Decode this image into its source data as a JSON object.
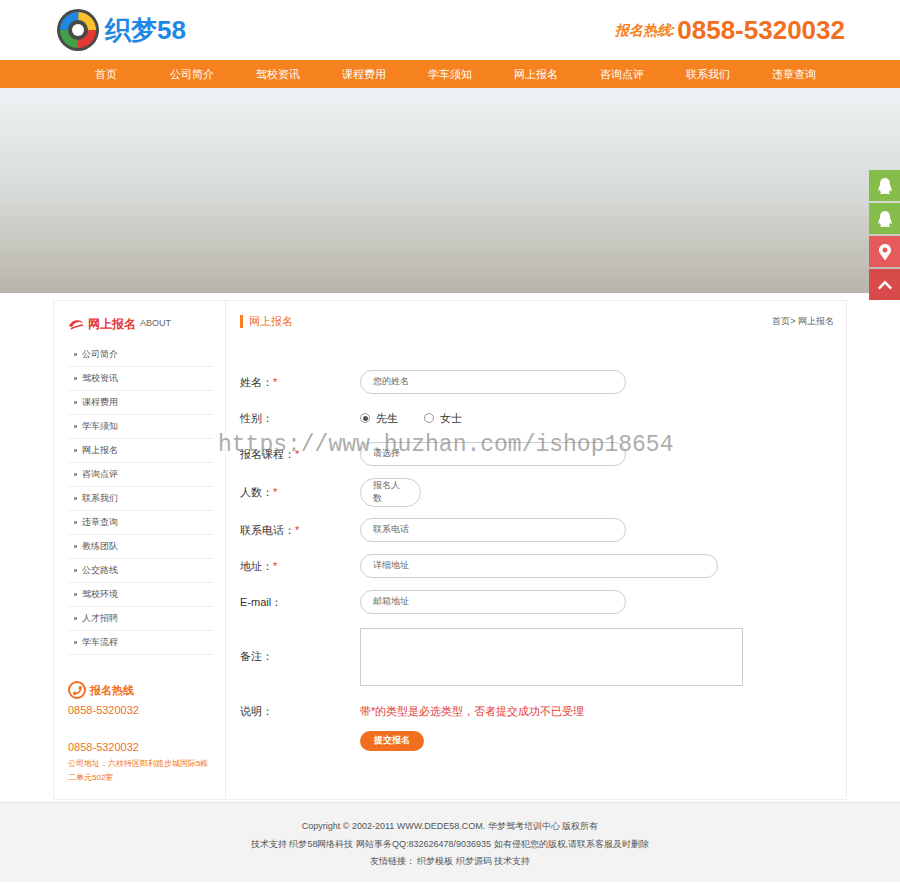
{
  "header": {
    "logo": "织梦58",
    "hotline_label": "报名热线:",
    "hotline": "0858-5320032"
  },
  "nav": [
    "首页",
    "公司简介",
    "驾校资讯",
    "课程费用",
    "学车须知",
    "网上报名",
    "咨询点评",
    "联系我们",
    "违章查询"
  ],
  "watermark": "https://www.huzhan.com/ishop18654",
  "float_buttons": [
    {
      "kind": "qq",
      "color": "#86bd4a"
    },
    {
      "kind": "qq",
      "color": "#86bd4a"
    },
    {
      "kind": "location",
      "color": "#e55b5b"
    },
    {
      "kind": "top",
      "color": "#d94b4b"
    }
  ],
  "sidebar": {
    "title": "网上报名",
    "subtitle": "ABOUT",
    "items": [
      "公司简介",
      "驾校资讯",
      "课程费用",
      "学车须知",
      "网上报名",
      "咨询点评",
      "联系我们",
      "违章查询",
      "教练团队",
      "公交路线",
      "驾校环境",
      "人才招聘",
      "学车流程"
    ],
    "hotline_title": "报名热线",
    "phone1": "0858-5320032",
    "phone2": "0858-5320032",
    "address": "公司地址：六枝特区郎利路步城国际5栋二单元502室"
  },
  "main": {
    "title": "网上报名",
    "breadcrumb": "首页> 网上报名"
  },
  "form": {
    "fields": [
      {
        "label": "姓名：",
        "required": true,
        "kind": "text",
        "placeholder": "您的姓名"
      },
      {
        "label": "性别：",
        "required": false,
        "kind": "radio",
        "options": [
          {
            "label": "先生",
            "selected": true
          },
          {
            "label": "女士",
            "selected": false
          }
        ]
      },
      {
        "label": "报名课程：",
        "required": true,
        "kind": "select",
        "placeholder": "请选择"
      },
      {
        "label": "人数：",
        "required": true,
        "kind": "number",
        "placeholder": "报名人数"
      },
      {
        "label": "联系电话：",
        "required": true,
        "kind": "text",
        "placeholder": "联系电话"
      },
      {
        "label": "地址：",
        "required": true,
        "kind": "wide",
        "placeholder": "详细地址"
      },
      {
        "label": "E-mail：",
        "required": false,
        "kind": "text",
        "placeholder": "邮箱地址"
      },
      {
        "label": "备注：",
        "required": false,
        "kind": "textarea",
        "placeholder": ""
      }
    ],
    "note_label": "说明：",
    "note": "带*的类型是必选类型，否者提交成功不已受理",
    "submit": "提交报名",
    "required_mark": "*"
  },
  "footer": {
    "lines": [
      "Copyright © 2002-2011 WWW.DEDE58.COM. 华梦驾考培训中心 版权所有",
      "技术支持 织梦58网络科技 网站事务QQ:832626478/9036935 如有侵犯您的版权,请联系客服及时删除",
      "友情链接： 织梦模板 织梦源码 技术支持"
    ]
  }
}
